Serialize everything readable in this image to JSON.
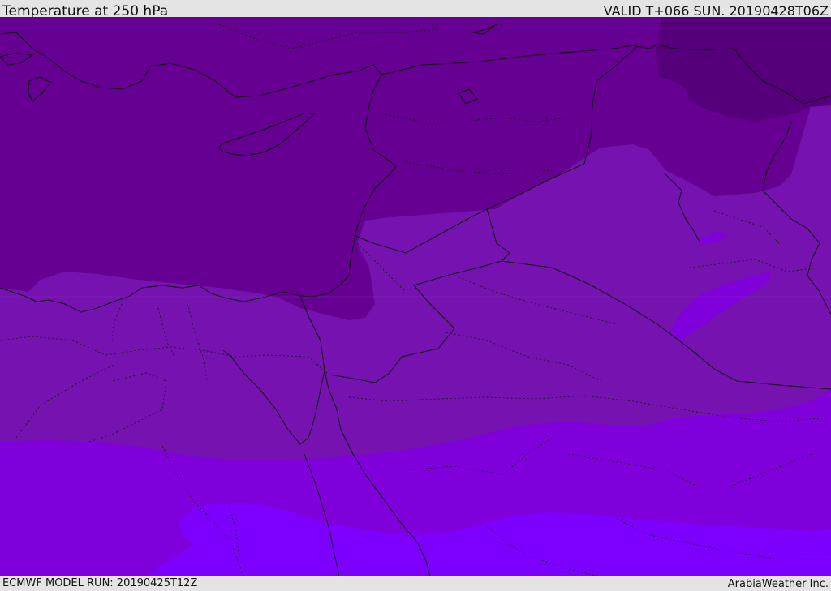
{
  "header": {
    "title": "Temperature at 250 hPa",
    "valid_time": "VALID T+066 SUN. 20190428T06Z"
  },
  "footer": {
    "model_run": "ECMWF MODEL RUN: 20190425T12Z",
    "credit": "ArabiaWeather Inc."
  },
  "map": {
    "field": "temperature_250hPa",
    "palette": {
      "coldest": "#55007a",
      "cold": "#650092",
      "mid": "#7512b0",
      "warm": "#8000dc",
      "warmest": "#7d00ff"
    },
    "line_color": "#111111"
  }
}
